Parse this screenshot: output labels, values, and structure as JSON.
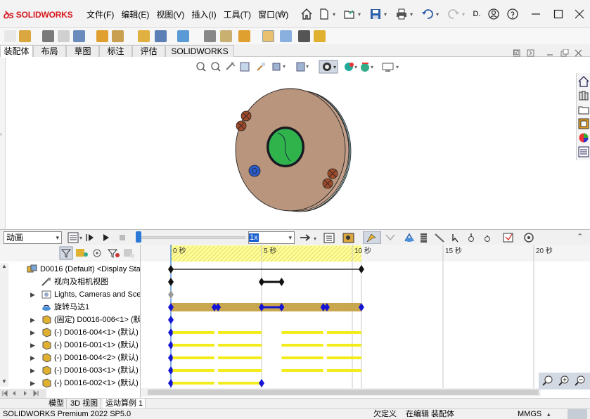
{
  "app": {
    "brand": "SOLIDWORKS",
    "menu": [
      "文件(F)",
      "编辑(E)",
      "视图(V)",
      "插入(I)",
      "工具(T)",
      "窗口(W)"
    ],
    "title_truncated": "D."
  },
  "command_tabs": [
    "装配体",
    "布局",
    "草图",
    "标注",
    "评估",
    "SOLIDWORKS 插件"
  ],
  "active_command_tab": "装配体",
  "motion": {
    "study_type": "动画",
    "playback_speed": "1x",
    "playhead_seconds": 0,
    "time_labels": [
      "0 秒",
      "5 秒",
      "10 秒",
      "15 秒",
      "20 秒"
    ],
    "time_values": [
      0,
      5,
      10,
      15,
      20
    ],
    "end_time": 10.5
  },
  "tree": [
    {
      "label": "D0016 (Default) <Display Sta",
      "icon": "assembly-icon",
      "expand": "collapse"
    },
    {
      "label": "视向及相机视图",
      "icon": "camera-view-icon",
      "expand": ""
    },
    {
      "label": "Lights, Cameras and Sce",
      "icon": "lights-icon",
      "expand": "expand"
    },
    {
      "label": "旋转马达1",
      "icon": "rotary-motor-icon",
      "expand": ""
    },
    {
      "label": "(固定) D0016-006<1> (默",
      "icon": "part-icon",
      "expand": "expand"
    },
    {
      "label": "(-) D0016-004<1> (默认)",
      "icon": "part-icon",
      "expand": "expand"
    },
    {
      "label": "(-) D0016-001<1> (默认)",
      "icon": "part-icon",
      "expand": "expand"
    },
    {
      "label": "(-) D0016-004<2> (默认)",
      "icon": "part-icon",
      "expand": "expand"
    },
    {
      "label": "(-) D0016-003<1> (默认)",
      "icon": "part-icon",
      "expand": "expand"
    },
    {
      "label": "(-) D0016-002<1> (默认)",
      "icon": "part-icon",
      "expand": "expand"
    }
  ],
  "bottom_tabs": [
    "模型",
    "3D 视图",
    "运动算例 1"
  ],
  "active_bottom_tab": "运动算例 1",
  "status": {
    "product": "SOLIDWORKS Premium 2022 SP5.0",
    "definition": "欠定义",
    "mode": "在编辑 装配体",
    "units": "MMGS"
  },
  "colors": {
    "brand_red": "#d71920",
    "part_body": "#b8957c",
    "hole_green": "#2fb34a",
    "timebar_gold": "#c9a74e",
    "keyframe_blue": "#1414d2",
    "component_yellow": "#f3ec1d"
  }
}
